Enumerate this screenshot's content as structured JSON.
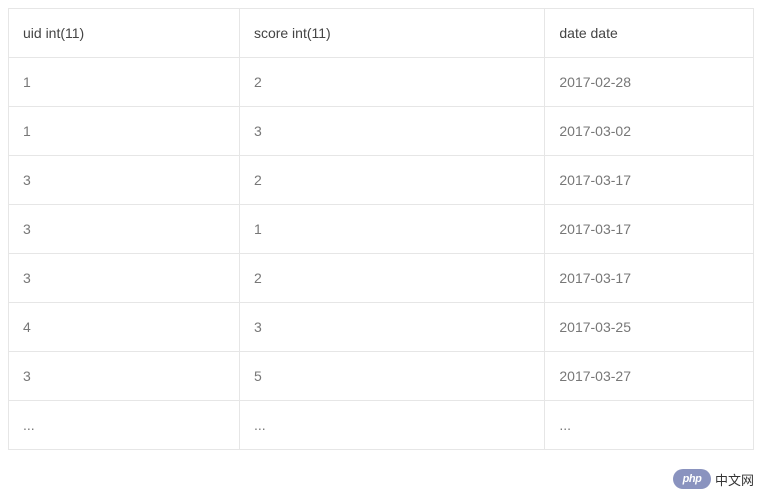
{
  "table": {
    "headers": {
      "uid": "uid int(11)",
      "score": "score int(11)",
      "date": "date date"
    },
    "rows": [
      {
        "uid": "1",
        "score": "2",
        "date": "2017-02-28"
      },
      {
        "uid": "1",
        "score": "3",
        "date": "2017-03-02"
      },
      {
        "uid": "3",
        "score": "2",
        "date": "2017-03-17"
      },
      {
        "uid": "3",
        "score": "1",
        "date": "2017-03-17"
      },
      {
        "uid": "3",
        "score": "2",
        "date": "2017-03-17"
      },
      {
        "uid": "4",
        "score": "3",
        "date": "2017-03-25"
      },
      {
        "uid": "3",
        "score": "5",
        "date": "2017-03-27"
      },
      {
        "uid": "...",
        "score": "...",
        "date": "..."
      }
    ]
  },
  "watermark": {
    "badge": "php",
    "text": "中文网"
  }
}
